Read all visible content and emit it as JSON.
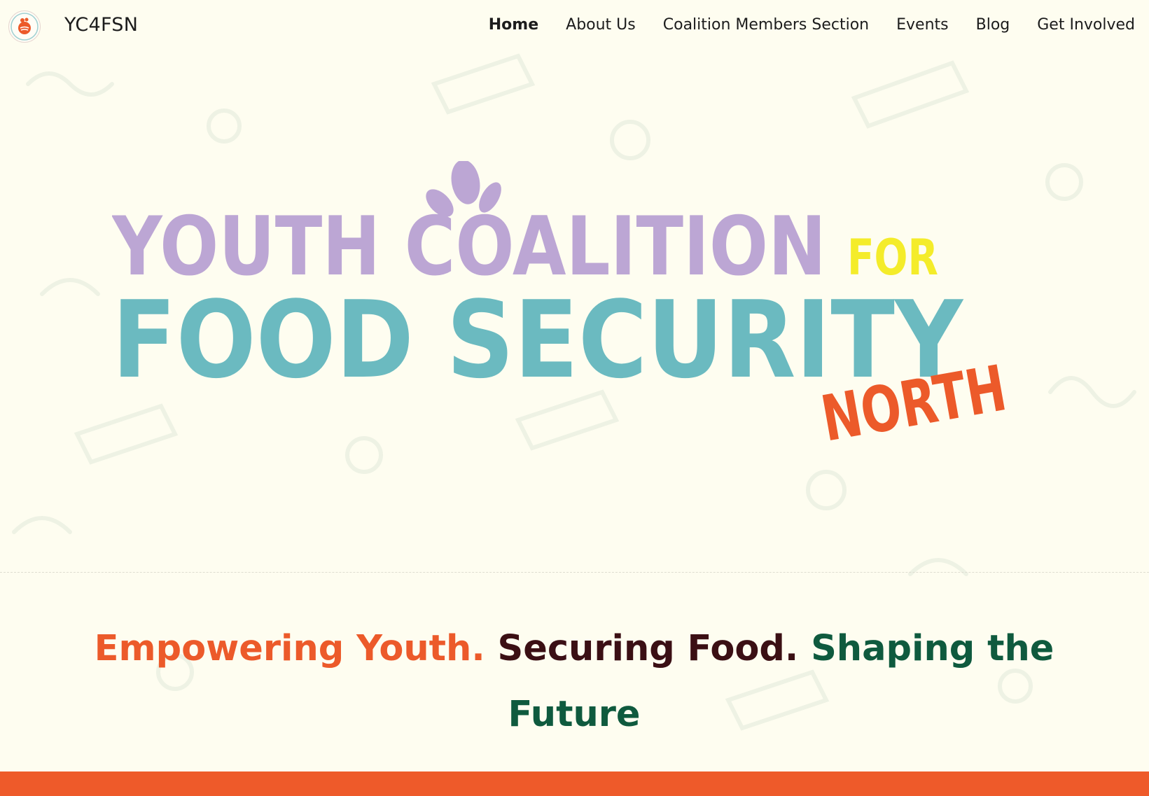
{
  "nav": {
    "site_title": "YC4FSN",
    "logo_icon": "coalition-seal-logo",
    "items": [
      {
        "label": "Home",
        "active": true
      },
      {
        "label": "About Us",
        "active": false
      },
      {
        "label": "Coalition Members Section",
        "active": false
      },
      {
        "label": "Events",
        "active": false
      },
      {
        "label": "Blog",
        "active": false
      },
      {
        "label": "Get Involved",
        "active": false
      }
    ]
  },
  "hero": {
    "logo": {
      "line1": "YOUTH COALITION",
      "line1_suffix": "FOR",
      "line2": "FOOD SECURITY",
      "line3": "NORTH"
    },
    "colors": {
      "purple": "#bca6d4",
      "yellow": "#f4ec2a",
      "teal": "#6bbac0",
      "orange": "#ec5a2a"
    }
  },
  "tagline": {
    "part1": "Empowering Youth.",
    "part2": "Securing Food.",
    "part3": "Shaping the Future"
  },
  "colors": {
    "background": "#fefdf0",
    "band": "#ee5a2a",
    "tagline_orange": "#ec5a2a",
    "tagline_maroon": "#3b0f14",
    "tagline_green": "#0f5a3e"
  }
}
